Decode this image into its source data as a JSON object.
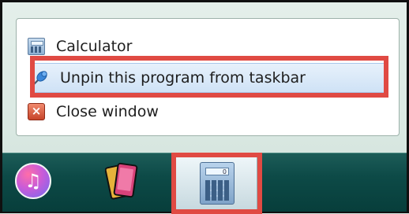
{
  "jump_list": {
    "items": [
      {
        "label": "Calculator",
        "icon": "calculator-icon"
      },
      {
        "label": "Unpin this program from taskbar",
        "icon": "pin-icon"
      },
      {
        "label": "Close window",
        "icon": "close-icon"
      }
    ]
  },
  "taskbar": {
    "buttons": [
      {
        "app": "iTunes",
        "icon": "itunes-icon"
      },
      {
        "app": "Phone app",
        "icon": "phone-icon"
      },
      {
        "app": "Calculator",
        "icon": "calculator-icon",
        "screen_digit": "0"
      }
    ]
  },
  "colors": {
    "highlight_border": "#e04a43",
    "selected_item_bg": "#cfe2f6",
    "taskbar_bg": "#0d4a47"
  }
}
